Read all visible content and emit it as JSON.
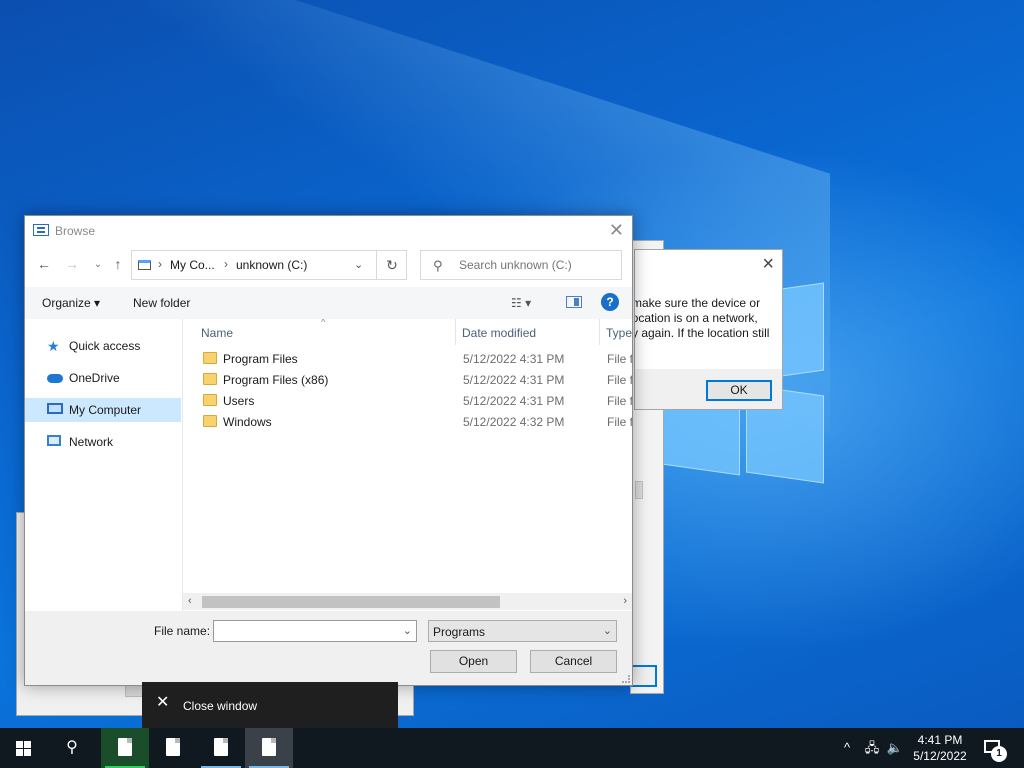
{
  "dialog": {
    "title": "Browse",
    "nav": {
      "back_icon": "arrow-left-icon",
      "forward_icon": "arrow-right-icon",
      "up_icon": "arrow-up-icon"
    },
    "address": {
      "crumbs": [
        "My Co...",
        "unknown (C:)"
      ],
      "refresh_icon": "refresh-icon"
    },
    "search": {
      "placeholder": "Search unknown (C:)"
    },
    "commands": {
      "organize": "Organize ▾",
      "new_folder": "New folder"
    },
    "nav_pane": [
      {
        "label": "Quick access",
        "icon": "star-icon"
      },
      {
        "label": "OneDrive",
        "icon": "cloud-icon"
      },
      {
        "label": "My Computer",
        "icon": "computer-icon",
        "selected": true
      },
      {
        "label": "Network",
        "icon": "network-icon"
      }
    ],
    "columns": {
      "name": "Name",
      "date": "Date modified",
      "type": "Type"
    },
    "files": [
      {
        "name": "Program Files",
        "date": "5/12/2022 4:31 PM",
        "type": "File fo"
      },
      {
        "name": "Program Files (x86)",
        "date": "5/12/2022 4:31 PM",
        "type": "File fo"
      },
      {
        "name": "Users",
        "date": "5/12/2022 4:31 PM",
        "type": "File fo"
      },
      {
        "name": "Windows",
        "date": "5/12/2022 4:32 PM",
        "type": "File fo"
      }
    ],
    "file_name": {
      "label": "File name:",
      "value": ""
    },
    "filter": {
      "value": "Programs"
    },
    "buttons": {
      "open": "Open",
      "cancel": "Cancel"
    }
  },
  "message_box": {
    "lines": [
      "make sure the device or",
      "location is on a network,",
      "y again. If the location still"
    ],
    "ok": "OK"
  },
  "tooltip": {
    "label": "Close window"
  },
  "taskbar": {
    "time": "4:41 PM",
    "date": "5/12/2022",
    "notification_count": "1"
  },
  "colors": {
    "accent": "#0078d7",
    "selection": "#cce8ff",
    "taskbar": "#101820"
  }
}
